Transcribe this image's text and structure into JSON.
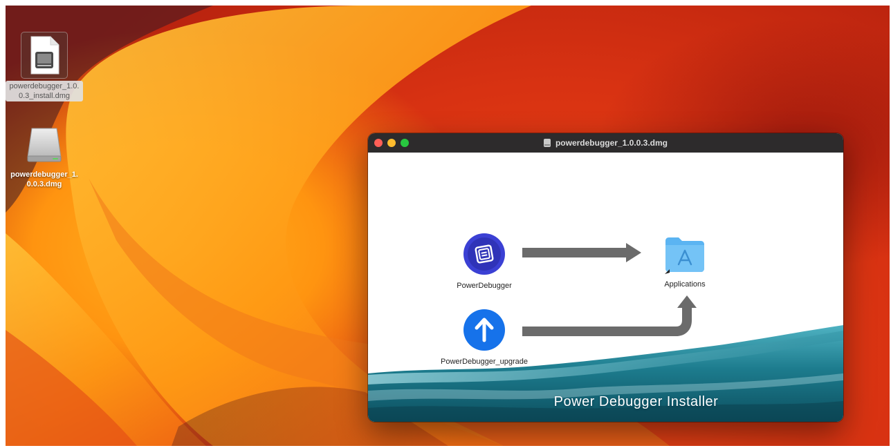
{
  "desktop": {
    "icons": [
      {
        "label": "powerdebugger_1.0.0.3_install.dmg",
        "icon": "installer-document-icon",
        "selected": true
      },
      {
        "label": "powerdebugger_1.0.0.3.dmg",
        "icon": "disk-image-icon",
        "selected": false
      }
    ]
  },
  "window": {
    "title": "powerdebugger_1.0.0.3.dmg",
    "title_icon": "disk-image-icon",
    "items": {
      "app": {
        "label": "PowerDebugger",
        "icon": "powerdebugger-app-icon"
      },
      "upgrade": {
        "label": "PowerDebugger_upgrade",
        "icon": "upgrade-arrow-icon"
      },
      "applications": {
        "label": "Applications",
        "icon": "applications-folder-icon"
      }
    },
    "background_text": "Power Debugger Installer"
  },
  "colors": {
    "titlebar": "#2d2b2c",
    "app_icon_blue": "#3b40d4",
    "upgrade_blue": "#1672ea",
    "folder_blue": "#5bb4f2",
    "arrow_gray": "#6b6b6b",
    "water_teal": "#1d7c8e"
  }
}
